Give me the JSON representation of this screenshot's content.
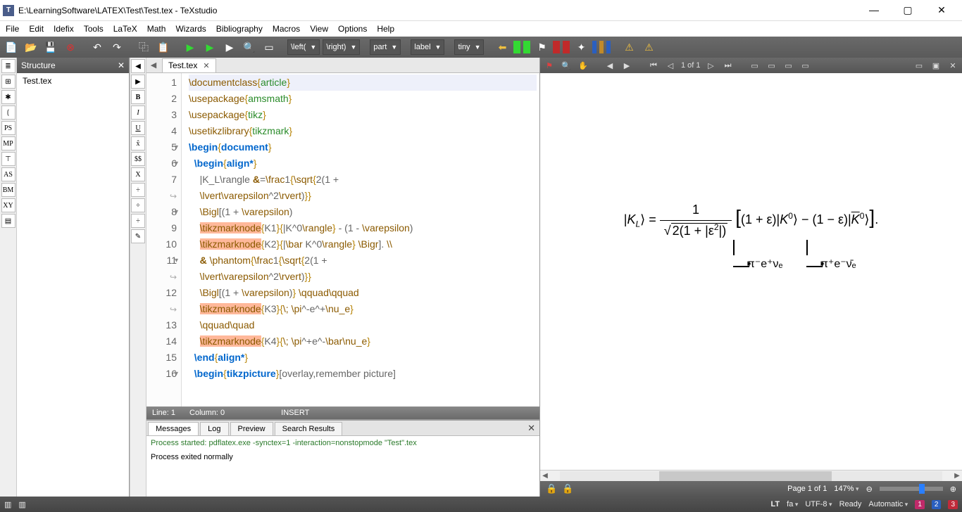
{
  "window": {
    "title": "E:\\LearningSoftware\\LATEX\\Test\\Test.tex - TeXstudio",
    "app_icon_letter": "T"
  },
  "menu": [
    "File",
    "Edit",
    "Idefix",
    "Tools",
    "LaTeX",
    "Math",
    "Wizards",
    "Bibliography",
    "Macros",
    "View",
    "Options",
    "Help"
  ],
  "toolbar": {
    "combos": {
      "left": "\\left(",
      "right": "\\right)",
      "part": "part",
      "label": "label",
      "tiny": "tiny"
    }
  },
  "structure": {
    "title": "Structure",
    "items": [
      "Test.tex"
    ]
  },
  "left_icons_a": [
    "≣",
    "⊞",
    "✱",
    "⟮",
    "PS",
    "MP",
    "⊤",
    "AS",
    "BM",
    "XY",
    "▤"
  ],
  "left_icons_b": [
    "B",
    "I",
    "U",
    "x̂",
    "$$",
    "X",
    "÷",
    "÷",
    "÷",
    "✎"
  ],
  "tabs": {
    "file": "Test.tex"
  },
  "code": {
    "lines": [
      {
        "n": "1",
        "wrap": false,
        "fold": false
      },
      {
        "n": "2",
        "wrap": false,
        "fold": false
      },
      {
        "n": "3",
        "wrap": false,
        "fold": false
      },
      {
        "n": "4",
        "wrap": false,
        "fold": false
      },
      {
        "n": "5",
        "wrap": false,
        "fold": true
      },
      {
        "n": "6",
        "wrap": false,
        "fold": true
      },
      {
        "n": "7",
        "wrap": false,
        "fold": false
      },
      {
        "n": "",
        "wrap": true,
        "fold": false
      },
      {
        "n": "8",
        "wrap": false,
        "fold": true
      },
      {
        "n": "9",
        "wrap": false,
        "fold": false
      },
      {
        "n": "10",
        "wrap": false,
        "fold": false
      },
      {
        "n": "11",
        "wrap": false,
        "fold": true
      },
      {
        "n": "",
        "wrap": true,
        "fold": false
      },
      {
        "n": "12",
        "wrap": false,
        "fold": false
      },
      {
        "n": "",
        "wrap": true,
        "fold": false
      },
      {
        "n": "13",
        "wrap": false,
        "fold": false
      },
      {
        "n": "14",
        "wrap": false,
        "fold": false
      },
      {
        "n": "15",
        "wrap": false,
        "fold": false
      },
      {
        "n": "16",
        "wrap": false,
        "fold": true
      }
    ]
  },
  "editor_status": {
    "line": "Line: 1",
    "col": "Column: 0",
    "mode": "INSERT"
  },
  "messages": {
    "tabs": [
      "Messages",
      "Log",
      "Preview",
      "Search Results"
    ],
    "active": 0,
    "line1": "Process started: pdflatex.exe -synctex=1 -interaction=nonstopmode \"Test\".tex",
    "line2": "Process exited normally"
  },
  "preview": {
    "page_label": "1 of 1",
    "arrow1": "π⁻e⁺νₑ",
    "arrow2": "π⁺e⁻ν̄ₑ",
    "status_page": "Page 1 of 1",
    "zoom": "147%"
  },
  "appstatus": {
    "lt": "LT",
    "lang": "fa",
    "enc": "UTF-8",
    "ready": "Ready",
    "auto": "Automatic",
    "b1": "1",
    "b2": "2",
    "b3": "3"
  }
}
